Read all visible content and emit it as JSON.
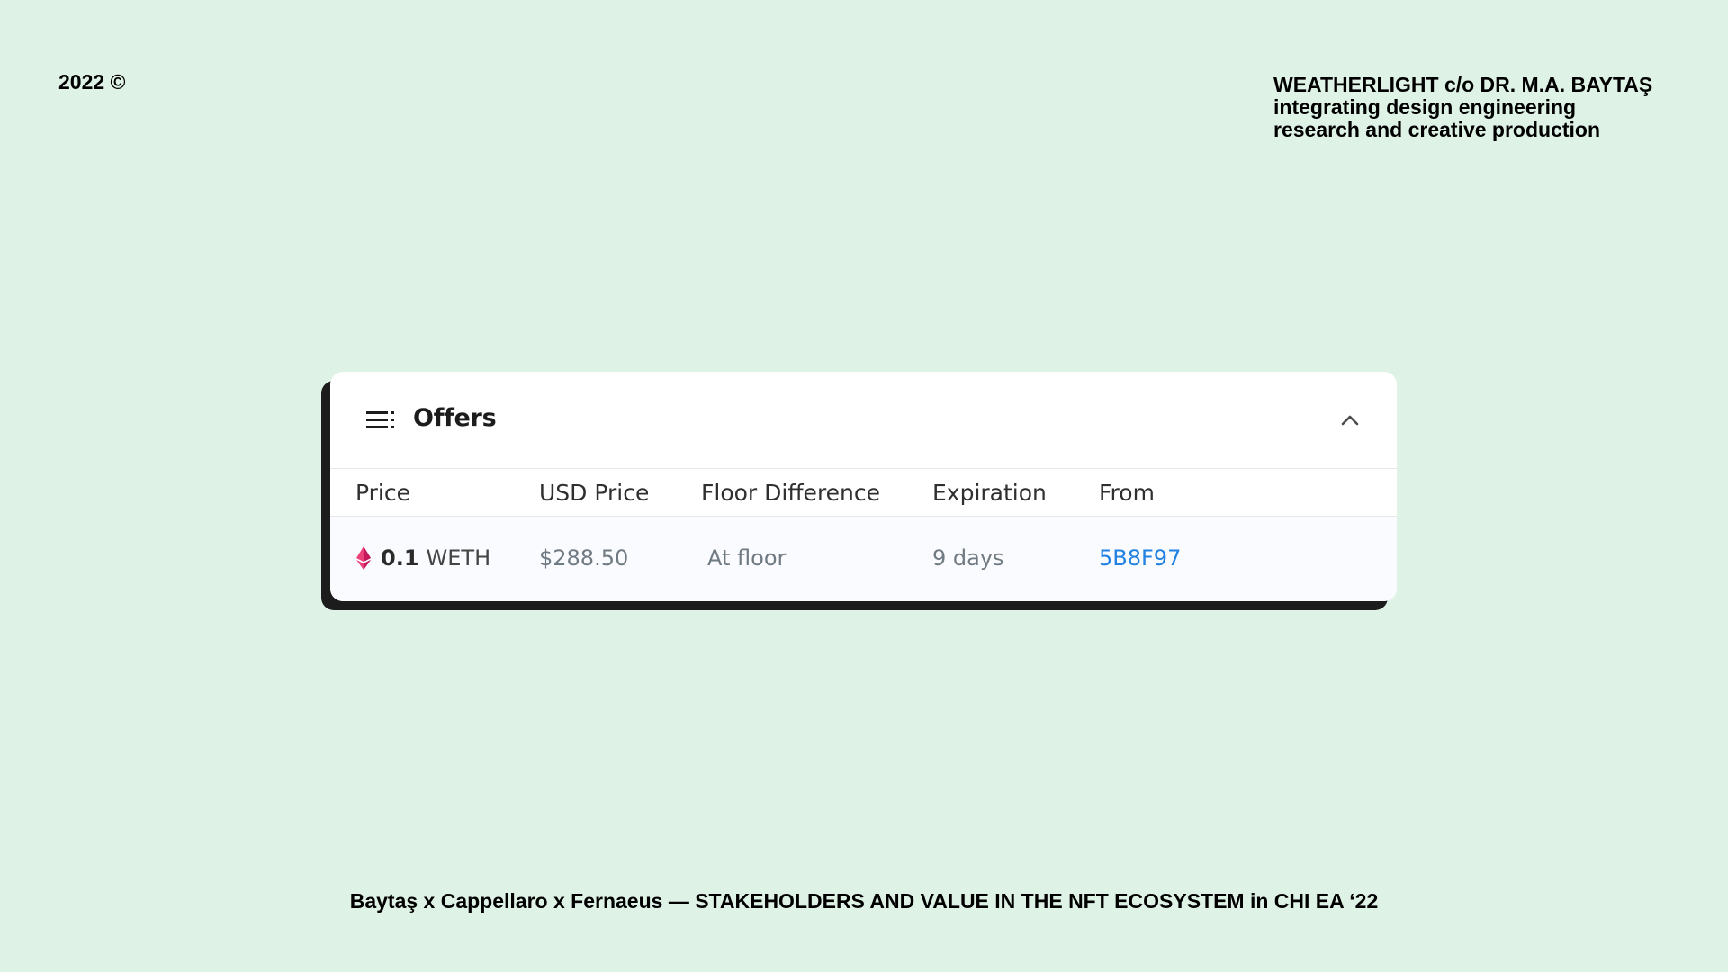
{
  "slide": {
    "year_mark": "2022 ©",
    "org_lines": [
      "WEATHERLIGHT c/o DR. M.A. BAYTAŞ",
      "integrating design engineering",
      "research and creative production"
    ],
    "footer": "Baytaş x Cappellaro x Fernaeus — STAKEHOLDERS AND VALUE IN THE NFT ECOSYSTEM in CHI EA ‘22"
  },
  "offers": {
    "title": "Offers",
    "icon": "list-icon",
    "collapse_icon": "chevron-up-icon",
    "columns": [
      "Price",
      "USD Price",
      "Floor Difference",
      "Expiration",
      "From"
    ],
    "rows": [
      {
        "price_icon": "eth-icon",
        "price_amount": "0.1",
        "price_token": "WETH",
        "usd_price": "$288.50",
        "floor_difference": "At floor",
        "expiration": "9 days",
        "from": "5B8F97"
      }
    ]
  },
  "colors": {
    "background": "#dff2e6",
    "link": "#2081e2",
    "eth_icon": "#ec407a"
  }
}
